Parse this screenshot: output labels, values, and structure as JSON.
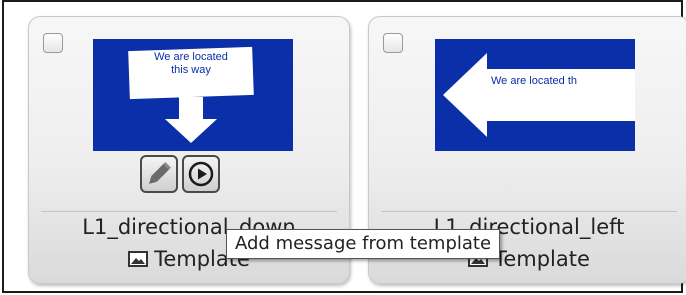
{
  "cards": [
    {
      "thumbnail_text": "We are located\nthis way",
      "title": "L1_directional_down",
      "type_label": "Template",
      "type_icon": "image-icon",
      "actions": [
        "pencil-icon",
        "play-icon"
      ]
    },
    {
      "thumbnail_text": "We are located th",
      "title": "L1_directional_left",
      "type_label": "Template",
      "type_icon": "image-icon"
    }
  ],
  "tooltip": {
    "text": "Add message from template"
  },
  "colors": {
    "thumbnail_bg": "#0a2fa8",
    "sign_fill": "#ffffff"
  }
}
